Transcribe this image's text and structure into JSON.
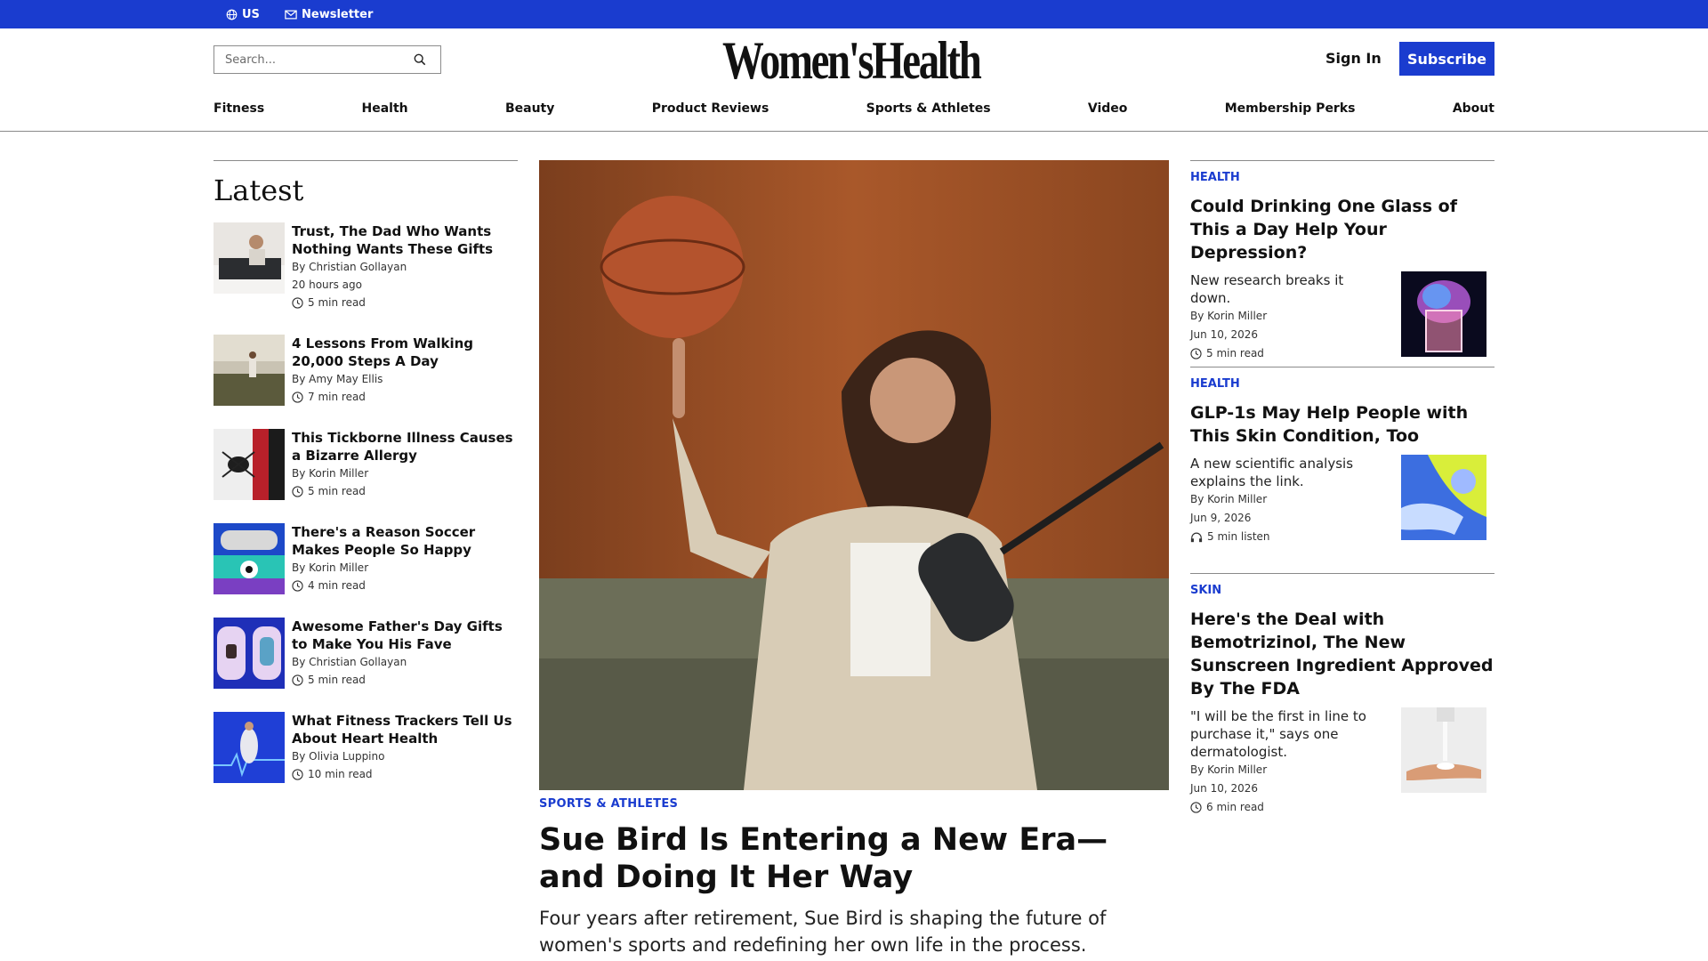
{
  "topbar": {
    "region_label": "US",
    "newsletter_label": "Newsletter"
  },
  "header": {
    "search_placeholder": "Search...",
    "logo_text": "Women'sHealth",
    "signin_label": "Sign In",
    "subscribe_label": "Subscribe"
  },
  "nav": {
    "items": [
      "Fitness",
      "Health",
      "Beauty",
      "Product Reviews",
      "Sports & Athletes",
      "Video",
      "Membership Perks",
      "About"
    ]
  },
  "latest": {
    "heading": "Latest",
    "items": [
      {
        "title": "Trust, The Dad Who Wants Nothing Wants These Gifts",
        "author": "By Christian Gollayan",
        "time": "20 hours ago",
        "read": "5 min read"
      },
      {
        "title": "4 Lessons From Walking 20,000 Steps A Day",
        "author": "By Amy May Ellis",
        "read": "7 min read"
      },
      {
        "title": "This Tickborne Illness Causes a Bizarre Allergy",
        "author": "By Korin Miller",
        "read": "5 min read"
      },
      {
        "title": "There's a Reason Soccer Makes People So Happy",
        "author": "By Korin Miller",
        "read": "4 min read"
      },
      {
        "title": "Awesome Father's Day Gifts to Make You His Fave",
        "author": "By Christian Gollayan",
        "read": "5 min read"
      },
      {
        "title": "What Fitness Trackers Tell Us About Heart Health",
        "author": "By Olivia Luppino",
        "read": "10 min read"
      }
    ]
  },
  "hero": {
    "category": "SPORTS & ATHLETES",
    "title": "Sue Bird Is Entering a New Era—and Doing It Her Way",
    "dek": "Four years after retirement, Sue Bird is shaping the future of women's sports and redefining her own life in the process."
  },
  "right": {
    "cards": [
      {
        "category": "HEALTH",
        "title": "Could Drinking One Glass of This a Day Help Your Depression?",
        "dek": "New research breaks it down.",
        "author": "By Korin Miller",
        "date": "Jun 10, 2026",
        "read": "5 min read"
      },
      {
        "category": "HEALTH",
        "title": "GLP-1s May Help People with This Skin Condition, Too",
        "dek": "A new scientific analysis explains the link.",
        "author": "By Korin Miller",
        "date": "Jun 9, 2026",
        "read": "5 min listen"
      },
      {
        "category": "SKIN",
        "title": "Here's the Deal with Bemotrizinol, The New Sunscreen Ingredient Approved By The FDA",
        "dek": "\"I will be the first in line to purchase it,\" says one dermatologist.",
        "author": "By Korin Miller",
        "date": "Jun 10, 2026",
        "read": "6 min read"
      }
    ]
  },
  "colors": {
    "brand_blue": "#1a3ccf",
    "text": "#111111"
  }
}
